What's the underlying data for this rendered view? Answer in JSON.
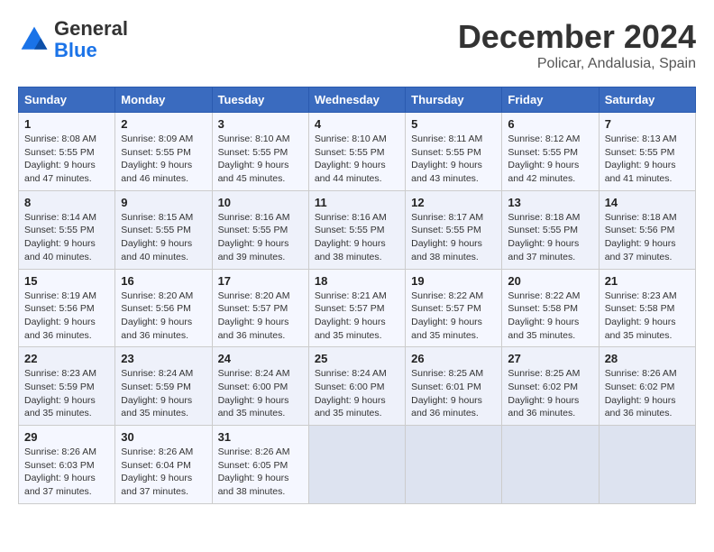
{
  "header": {
    "logo_general": "General",
    "logo_blue": "Blue",
    "month": "December 2024",
    "location": "Policar, Andalusia, Spain"
  },
  "weekdays": [
    "Sunday",
    "Monday",
    "Tuesday",
    "Wednesday",
    "Thursday",
    "Friday",
    "Saturday"
  ],
  "weeks": [
    [
      {
        "day": "1",
        "sunrise": "Sunrise: 8:08 AM",
        "sunset": "Sunset: 5:55 PM",
        "daylight": "Daylight: 9 hours and 47 minutes."
      },
      {
        "day": "2",
        "sunrise": "Sunrise: 8:09 AM",
        "sunset": "Sunset: 5:55 PM",
        "daylight": "Daylight: 9 hours and 46 minutes."
      },
      {
        "day": "3",
        "sunrise": "Sunrise: 8:10 AM",
        "sunset": "Sunset: 5:55 PM",
        "daylight": "Daylight: 9 hours and 45 minutes."
      },
      {
        "day": "4",
        "sunrise": "Sunrise: 8:10 AM",
        "sunset": "Sunset: 5:55 PM",
        "daylight": "Daylight: 9 hours and 44 minutes."
      },
      {
        "day": "5",
        "sunrise": "Sunrise: 8:11 AM",
        "sunset": "Sunset: 5:55 PM",
        "daylight": "Daylight: 9 hours and 43 minutes."
      },
      {
        "day": "6",
        "sunrise": "Sunrise: 8:12 AM",
        "sunset": "Sunset: 5:55 PM",
        "daylight": "Daylight: 9 hours and 42 minutes."
      },
      {
        "day": "7",
        "sunrise": "Sunrise: 8:13 AM",
        "sunset": "Sunset: 5:55 PM",
        "daylight": "Daylight: 9 hours and 41 minutes."
      }
    ],
    [
      {
        "day": "8",
        "sunrise": "Sunrise: 8:14 AM",
        "sunset": "Sunset: 5:55 PM",
        "daylight": "Daylight: 9 hours and 40 minutes."
      },
      {
        "day": "9",
        "sunrise": "Sunrise: 8:15 AM",
        "sunset": "Sunset: 5:55 PM",
        "daylight": "Daylight: 9 hours and 40 minutes."
      },
      {
        "day": "10",
        "sunrise": "Sunrise: 8:16 AM",
        "sunset": "Sunset: 5:55 PM",
        "daylight": "Daylight: 9 hours and 39 minutes."
      },
      {
        "day": "11",
        "sunrise": "Sunrise: 8:16 AM",
        "sunset": "Sunset: 5:55 PM",
        "daylight": "Daylight: 9 hours and 38 minutes."
      },
      {
        "day": "12",
        "sunrise": "Sunrise: 8:17 AM",
        "sunset": "Sunset: 5:55 PM",
        "daylight": "Daylight: 9 hours and 38 minutes."
      },
      {
        "day": "13",
        "sunrise": "Sunrise: 8:18 AM",
        "sunset": "Sunset: 5:55 PM",
        "daylight": "Daylight: 9 hours and 37 minutes."
      },
      {
        "day": "14",
        "sunrise": "Sunrise: 8:18 AM",
        "sunset": "Sunset: 5:56 PM",
        "daylight": "Daylight: 9 hours and 37 minutes."
      }
    ],
    [
      {
        "day": "15",
        "sunrise": "Sunrise: 8:19 AM",
        "sunset": "Sunset: 5:56 PM",
        "daylight": "Daylight: 9 hours and 36 minutes."
      },
      {
        "day": "16",
        "sunrise": "Sunrise: 8:20 AM",
        "sunset": "Sunset: 5:56 PM",
        "daylight": "Daylight: 9 hours and 36 minutes."
      },
      {
        "day": "17",
        "sunrise": "Sunrise: 8:20 AM",
        "sunset": "Sunset: 5:57 PM",
        "daylight": "Daylight: 9 hours and 36 minutes."
      },
      {
        "day": "18",
        "sunrise": "Sunrise: 8:21 AM",
        "sunset": "Sunset: 5:57 PM",
        "daylight": "Daylight: 9 hours and 35 minutes."
      },
      {
        "day": "19",
        "sunrise": "Sunrise: 8:22 AM",
        "sunset": "Sunset: 5:57 PM",
        "daylight": "Daylight: 9 hours and 35 minutes."
      },
      {
        "day": "20",
        "sunrise": "Sunrise: 8:22 AM",
        "sunset": "Sunset: 5:58 PM",
        "daylight": "Daylight: 9 hours and 35 minutes."
      },
      {
        "day": "21",
        "sunrise": "Sunrise: 8:23 AM",
        "sunset": "Sunset: 5:58 PM",
        "daylight": "Daylight: 9 hours and 35 minutes."
      }
    ],
    [
      {
        "day": "22",
        "sunrise": "Sunrise: 8:23 AM",
        "sunset": "Sunset: 5:59 PM",
        "daylight": "Daylight: 9 hours and 35 minutes."
      },
      {
        "day": "23",
        "sunrise": "Sunrise: 8:24 AM",
        "sunset": "Sunset: 5:59 PM",
        "daylight": "Daylight: 9 hours and 35 minutes."
      },
      {
        "day": "24",
        "sunrise": "Sunrise: 8:24 AM",
        "sunset": "Sunset: 6:00 PM",
        "daylight": "Daylight: 9 hours and 35 minutes."
      },
      {
        "day": "25",
        "sunrise": "Sunrise: 8:24 AM",
        "sunset": "Sunset: 6:00 PM",
        "daylight": "Daylight: 9 hours and 35 minutes."
      },
      {
        "day": "26",
        "sunrise": "Sunrise: 8:25 AM",
        "sunset": "Sunset: 6:01 PM",
        "daylight": "Daylight: 9 hours and 36 minutes."
      },
      {
        "day": "27",
        "sunrise": "Sunrise: 8:25 AM",
        "sunset": "Sunset: 6:02 PM",
        "daylight": "Daylight: 9 hours and 36 minutes."
      },
      {
        "day": "28",
        "sunrise": "Sunrise: 8:26 AM",
        "sunset": "Sunset: 6:02 PM",
        "daylight": "Daylight: 9 hours and 36 minutes."
      }
    ],
    [
      {
        "day": "29",
        "sunrise": "Sunrise: 8:26 AM",
        "sunset": "Sunset: 6:03 PM",
        "daylight": "Daylight: 9 hours and 37 minutes."
      },
      {
        "day": "30",
        "sunrise": "Sunrise: 8:26 AM",
        "sunset": "Sunset: 6:04 PM",
        "daylight": "Daylight: 9 hours and 37 minutes."
      },
      {
        "day": "31",
        "sunrise": "Sunrise: 8:26 AM",
        "sunset": "Sunset: 6:05 PM",
        "daylight": "Daylight: 9 hours and 38 minutes."
      },
      null,
      null,
      null,
      null
    ]
  ]
}
